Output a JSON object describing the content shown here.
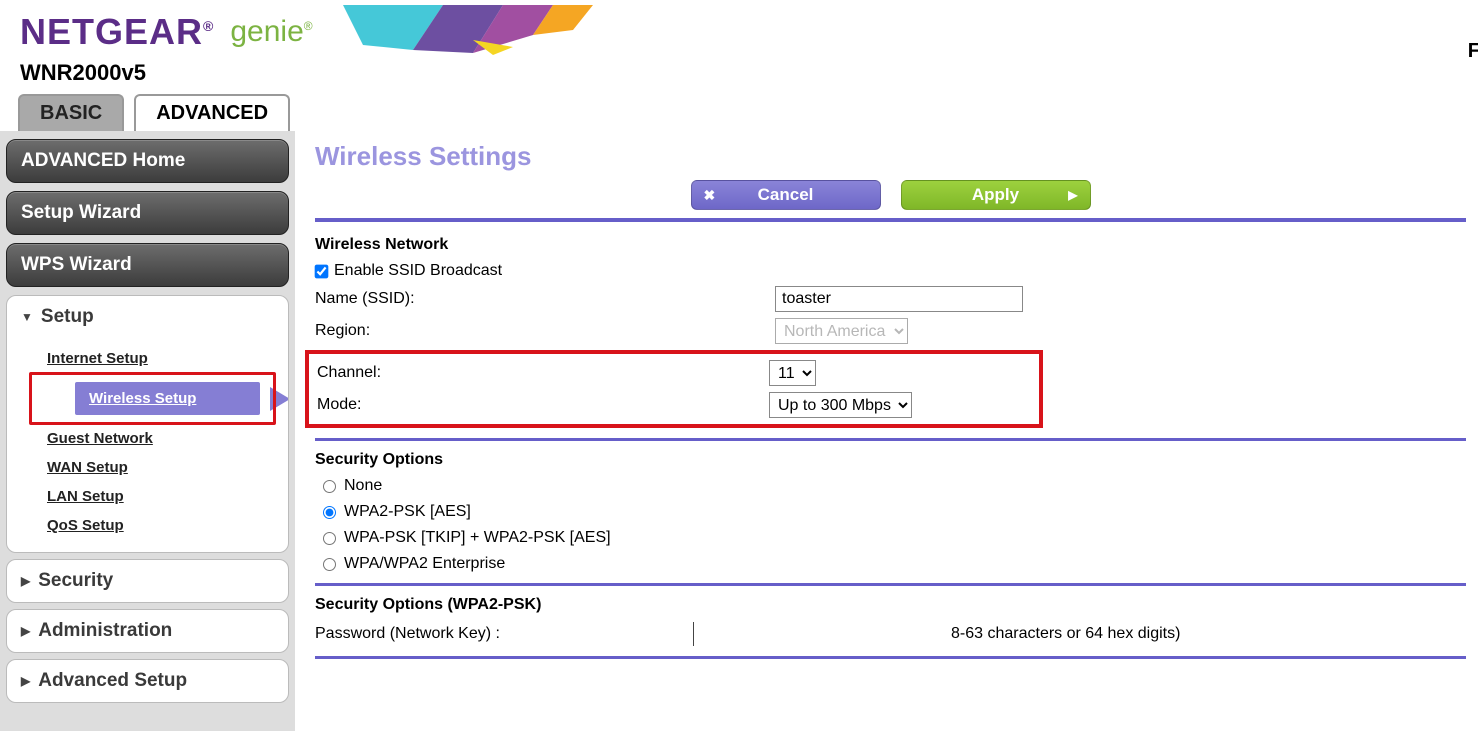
{
  "header": {
    "brand": "NETGEAR",
    "sub_brand": "genie",
    "model": "WNR2000v5"
  },
  "tabs": {
    "basic": "BASIC",
    "advanced": "ADVANCED"
  },
  "sidebar": {
    "advanced_home": "ADVANCED Home",
    "setup_wizard": "Setup Wizard",
    "wps_wizard": "WPS Wizard",
    "groups": {
      "setup": {
        "label": "Setup",
        "items": {
          "internet": "Internet Setup",
          "wireless": "Wireless Setup",
          "guest": "Guest Network",
          "wan": "WAN Setup",
          "lan": "LAN Setup",
          "qos": "QoS Setup"
        }
      },
      "security": {
        "label": "Security"
      },
      "administration": {
        "label": "Administration"
      },
      "advanced_setup": {
        "label": "Advanced Setup"
      }
    }
  },
  "page": {
    "title": "Wireless Settings",
    "cancel": "Cancel",
    "apply": "Apply"
  },
  "wireless_network": {
    "heading": "Wireless Network",
    "enable_ssid_label": "Enable SSID Broadcast",
    "enable_ssid_checked": true,
    "name_label": "Name (SSID):",
    "name_value": "toaster",
    "region_label": "Region:",
    "region_value": "North America",
    "channel_label": "Channel:",
    "channel_value": "11",
    "mode_label": "Mode:",
    "mode_value": "Up to 300 Mbps"
  },
  "security_options": {
    "heading": "Security Options",
    "none": "None",
    "wpa2psk": "WPA2-PSK [AES]",
    "wpapsk_mixed": "WPA-PSK [TKIP] + WPA2-PSK [AES]",
    "enterprise": "WPA/WPA2 Enterprise",
    "selected": "wpa2psk"
  },
  "security_psk": {
    "heading": "Security Options (WPA2-PSK)",
    "password_label": "Password (Network Key) :",
    "hint": "8-63 characters or 64 hex digits)"
  }
}
